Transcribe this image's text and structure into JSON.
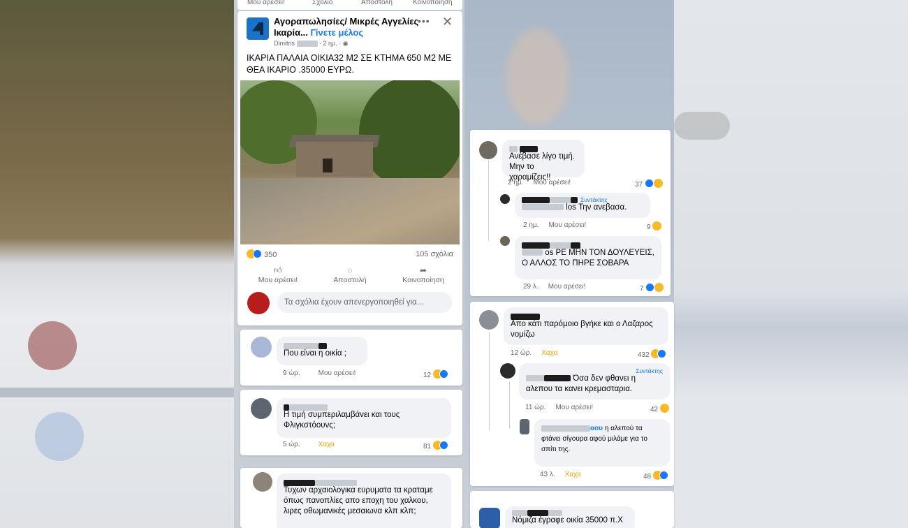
{
  "top_strip": {
    "like": "Μου αρέσει!",
    "comment": "Σχόλιο",
    "send": "Αποστολή",
    "share": "Κοινοποίηση"
  },
  "post": {
    "group_name": "Αγοραπωλησίες/ Μικρές Αγγελίες Ικαρία...",
    "join_label": "Γίνετε μέλος",
    "author": "Dimitris",
    "time": "· 2 ημ. ·",
    "text": "ΙΚΑΡΙΑ ΠΑΛΑΙΑ ΟΙΚΙΑ32 Μ2 ΣΕ ΚΤΗΜΑ 650 Μ2 ΜΕ ΘΕΑ ΙΚΑΡΙΟ .35000 ΕΥΡΩ.",
    "reaction_count": "350",
    "comment_count": "105 σχόλια",
    "actions": {
      "like": "Μου αρέσει!",
      "send": "Αποστολή",
      "share": "Κοινοποίηση"
    },
    "comment_input_placeholder": "Τα σχόλια έχουν απενεργοποιηθεί για..."
  },
  "comments_left": [
    {
      "text": "Που είναι η οικία ;",
      "time": "9 ώρ.",
      "action": "Μου αρέσει!",
      "reactions": "12"
    },
    {
      "text": "Η τιμή συμπεριλαμβάνει και τους Φλιγκστόουνς;",
      "time": "5 ώρ.",
      "action": "Χαχα",
      "reactions": "81"
    },
    {
      "text": "Τυχων αρχαιολογικα ευρυματα τα κραταμε όπως πανοπλίες απο εποχη του χαλκου, λιρες οθωμανικές μεσαιωνα κλπ κλπ;"
    }
  ],
  "comments_right_top": [
    {
      "text": "Ανέβασε λίγο τιμή. Μην το χαραμίζεις!!",
      "time": "2 ημ.",
      "action": "Μου αρέσει!",
      "reactions": "37"
    },
    {
      "author_badge": "Συντάκτης",
      "text_visible": "los Την ανεβασα.",
      "time": "2 ημ.",
      "action": "Μου αρέσει!",
      "reactions": "9"
    },
    {
      "text_visible": "os ΡΕ ΜΗΝ ΤΟΝ ΔΟΥΛΕΥΕΙΣ, Ο ΑΛΛΟΣ ΤΟ ΠΗΡΕ ΣΟΒΑΡΑ",
      "time": "29 λ.",
      "action": "Μου αρέσει!",
      "reactions": "7"
    }
  ],
  "comments_right_mid": [
    {
      "text": "Απο κάτι παρόμοιο βγήκε και ο Λαζαρος νομίζω",
      "time": "12 ώρ.",
      "action": "Χαχα",
      "reactions": "432"
    },
    {
      "author_badge": "Συντάκτης",
      "text_visible": "Όσα δεν φθανει η αλεπου τα κανει κρεμασταρια.",
      "time": "11 ώρ.",
      "action": "Μου αρέσει!",
      "reactions": "42"
    },
    {
      "name_suffix": "αου",
      "text_visible": "η αλεπού τα φτάνει σίγουρα αφού μιλάμε για το σπίτι της.",
      "time": "43 λ.",
      "action": "Χαχα",
      "reactions": "48"
    }
  ],
  "comments_right_bottom": [
    {
      "text": "Νόμιζα έγραφε οικία 35000 π.Χ"
    }
  ]
}
